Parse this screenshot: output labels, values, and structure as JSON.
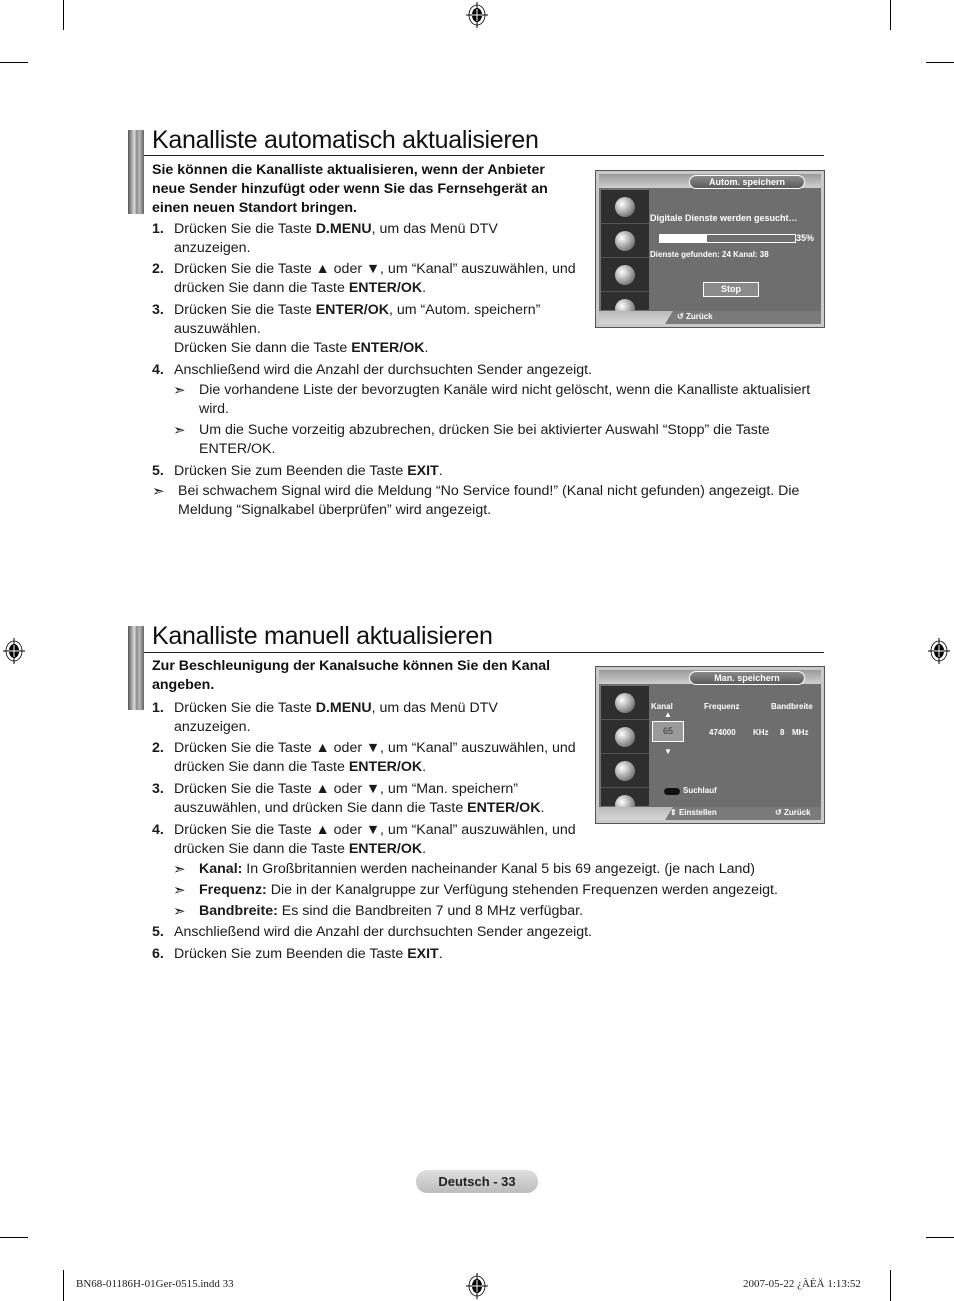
{
  "section1": {
    "title": "Kanalliste automatisch aktualisieren",
    "intro": [
      "Sie können die Kanalliste aktualisieren, wenn der Anbieter",
      "neue Sender hinzufügt oder wenn Sie das Fernsehgerät an",
      "einen neuen Standort bringen."
    ],
    "steps": [
      {
        "num": "1.",
        "lines": [
          [
            "Drücken Sie die Taste ",
            {
              "b": "D.MENU"
            },
            ", um das Menü DTV"
          ],
          [
            "anzuzeigen."
          ]
        ]
      },
      {
        "num": "2.",
        "lines": [
          [
            "Drücken Sie die Taste ▲ oder ▼, um “Kanal” auszuwählen, und"
          ],
          [
            "drücken Sie dann die Taste ",
            {
              "b": "ENTER/OK"
            },
            "."
          ]
        ]
      },
      {
        "num": "3.",
        "lines": [
          [
            "Drücken Sie die Taste ",
            {
              "b": "ENTER/OK"
            },
            ", um “Autom. speichern”"
          ],
          [
            "auszuwählen."
          ],
          [
            "Drücken Sie dann die Taste ",
            {
              "b": "ENTER/OK"
            },
            "."
          ]
        ]
      },
      {
        "num": "4.",
        "lines": [
          [
            "Anschließend wird die Anzahl der durchsuchten Sender angezeigt."
          ]
        ]
      },
      {
        "num": "5.",
        "lines": [
          [
            "Drücken Sie zum Beenden die Taste ",
            {
              "b": "EXIT"
            },
            "."
          ]
        ]
      }
    ],
    "notes_step4": [
      [
        "Die vorhandene Liste der bevorzugten Kanäle wird nicht gelöscht, wenn die Kanalliste aktualisiert",
        "wird."
      ],
      [
        "Um die Suche vorzeitig abzubrechen, drücken Sie bei aktivierter Auswahl “Stopp” die Taste",
        "ENTER/OK."
      ]
    ],
    "note_final": [
      "Bei schwachem Signal wird die Meldung “No Service found!” (Kanal nicht gefunden) angezeigt. Die",
      "Meldung “Signalkabel überprüfen” wird angezeigt."
    ],
    "osd": {
      "title": "Autom. speichern",
      "searching": "Digitale Dienste werden gesucht…",
      "progress_percent": 35,
      "progress_label": "35%",
      "found": "Dienste gefunden: 24   Kanal: 38",
      "stop_label": "Stop",
      "back_label": "Zurück",
      "back_icon": "return-icon"
    }
  },
  "section2": {
    "title": "Kanalliste manuell aktualisieren",
    "intro": [
      "Zur Beschleunigung der Kanalsuche können Sie den Kanal",
      "angeben."
    ],
    "steps": [
      {
        "num": "1.",
        "lines": [
          [
            "Drücken Sie die Taste ",
            {
              "b": "D.MENU"
            },
            ", um das Menü DTV"
          ],
          [
            "anzuzeigen."
          ]
        ]
      },
      {
        "num": "2.",
        "lines": [
          [
            "Drücken Sie die Taste ▲ oder ▼, um “Kanal” auszuwählen, und"
          ],
          [
            "drücken Sie dann die Taste ",
            {
              "b": "ENTER/OK"
            },
            "."
          ]
        ]
      },
      {
        "num": "3.",
        "lines": [
          [
            "Drücken Sie die Taste ▲ oder ▼, um “Man. speichern”"
          ],
          [
            "auszuwählen, und drücken Sie dann die Taste ",
            {
              "b": "ENTER/OK"
            },
            "."
          ]
        ]
      },
      {
        "num": "4.",
        "lines": [
          [
            "Drücken Sie die Taste ▲ oder ▼, um “Kanal” auszuwählen, und"
          ],
          [
            "drücken Sie dann die Taste ",
            {
              "b": "ENTER/OK"
            },
            "."
          ]
        ]
      },
      {
        "num": "5.",
        "lines": [
          [
            "Anschließend wird die Anzahl der durchsuchten Sender angezeigt."
          ]
        ]
      },
      {
        "num": "6.",
        "lines": [
          [
            "Drücken Sie zum Beenden die Taste ",
            {
              "b": "EXIT"
            },
            "."
          ]
        ]
      }
    ],
    "notes_step4": [
      [
        {
          "b": "Kanal:"
        },
        " In Großbritannien werden nacheinander Kanal 5 bis 69 angezeigt. (je nach Land)"
      ],
      [
        {
          "b": "Frequenz:"
        },
        " Die in der Kanalgruppe zur Verfügung stehenden Frequenzen werden angezeigt."
      ],
      [
        {
          "b": "Bandbreite:"
        },
        " Es sind die Bandbreiten 7 und 8 MHz verfügbar."
      ]
    ],
    "osd": {
      "title": "Man. speichern",
      "col_kanal": "Kanal",
      "col_frequenz": "Frequenz",
      "col_bandbreite": "Bandbreite",
      "kanal_value": "65",
      "frequenz_value": "474000",
      "frequenz_unit": "KHz",
      "bandbreite_value": "8",
      "bandbreite_unit": "MHz",
      "suchlauf_label": "Suchlauf",
      "einstellen_label": "Einstellen",
      "back_label": "Zurück"
    }
  },
  "footer": {
    "page_label": "Deutsch - 33",
    "file_info": "BN68-01186H-01Ger-0515.indd   33",
    "timestamp": "2007-05-22   ¿ÀÈÄ 1:13:52"
  },
  "colors": {
    "osd_bg": "#6e6e6e",
    "osd_frame": "#c9c9c9",
    "text": "#1a1a1a"
  }
}
